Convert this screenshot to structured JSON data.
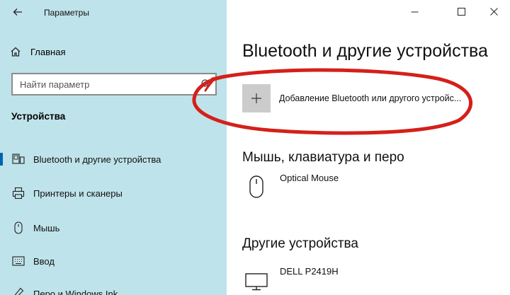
{
  "window": {
    "title": "Параметры",
    "controls": [
      "minimize",
      "maximize",
      "close"
    ]
  },
  "sidebar": {
    "home_label": "Главная",
    "search_placeholder": "Найти параметр",
    "section_title": "Устройства",
    "items": [
      {
        "label": "Bluetooth и другие устройства",
        "icon": "bluetooth-devices-icon",
        "selected": true
      },
      {
        "label": "Принтеры и сканеры",
        "icon": "printer-icon",
        "selected": false
      },
      {
        "label": "Мышь",
        "icon": "mouse-icon",
        "selected": false
      },
      {
        "label": "Ввод",
        "icon": "keyboard-icon",
        "selected": false
      },
      {
        "label": "Перо и Windows Ink",
        "icon": "pen-icon",
        "selected": false
      }
    ]
  },
  "main": {
    "page_title": "Bluetooth и другие устройства",
    "add_device_label": "Добавление Bluetooth или другого устройс...",
    "groups": [
      {
        "title": "Мышь, клавиатура и перо",
        "devices": [
          {
            "name": "Optical Mouse",
            "icon": "mouse-icon"
          }
        ]
      },
      {
        "title": "Другие устройства",
        "devices": [
          {
            "name": "DELL P2419H",
            "icon": "monitor-icon"
          }
        ]
      }
    ]
  },
  "colors": {
    "sidebar_bg": "#bfe3ea",
    "accent": "#0063b1",
    "annotation": "#d4201a"
  }
}
